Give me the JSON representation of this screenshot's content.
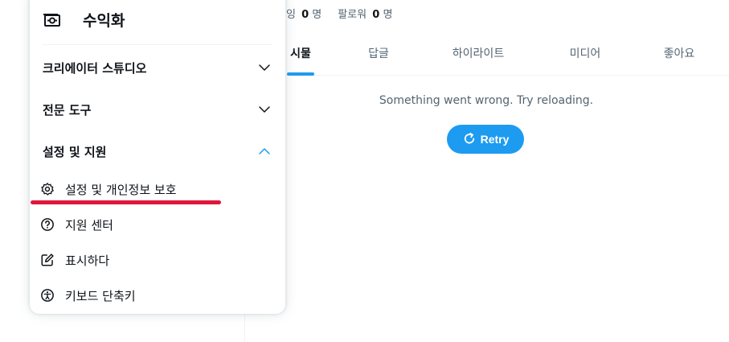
{
  "profile": {
    "following_label_tail": "잉",
    "following_count": "0",
    "following_unit": "명",
    "followers_label": "팔로워",
    "followers_count": "0",
    "followers_unit": "명"
  },
  "tabs": [
    {
      "label": "시물",
      "active": true
    },
    {
      "label": "답글",
      "active": false
    },
    {
      "label": "하이라이트",
      "active": false
    },
    {
      "label": "미디어",
      "active": false
    },
    {
      "label": "좋아요",
      "active": false
    }
  ],
  "feed": {
    "error_message": "Something went wrong. Try reloading.",
    "retry_label": "Retry"
  },
  "menu": {
    "monetization_label": "수익화",
    "sections": [
      {
        "label": "크리에이터 스튜디오",
        "expanded": false
      },
      {
        "label": "전문 도구",
        "expanded": false
      },
      {
        "label": "설정 및 지원",
        "expanded": true
      }
    ],
    "items": [
      {
        "label": "설정 및 개인정보 보호",
        "icon": "gear-icon"
      },
      {
        "label": "지원 센터",
        "icon": "help-circle-icon"
      },
      {
        "label": "표시하다",
        "icon": "edit-display-icon"
      },
      {
        "label": "키보드 단축키",
        "icon": "accessibility-icon"
      }
    ]
  },
  "colors": {
    "accent": "#1d9bf0",
    "annotation": "#e0163a",
    "text_primary": "#0f1419",
    "text_secondary": "#536471"
  }
}
